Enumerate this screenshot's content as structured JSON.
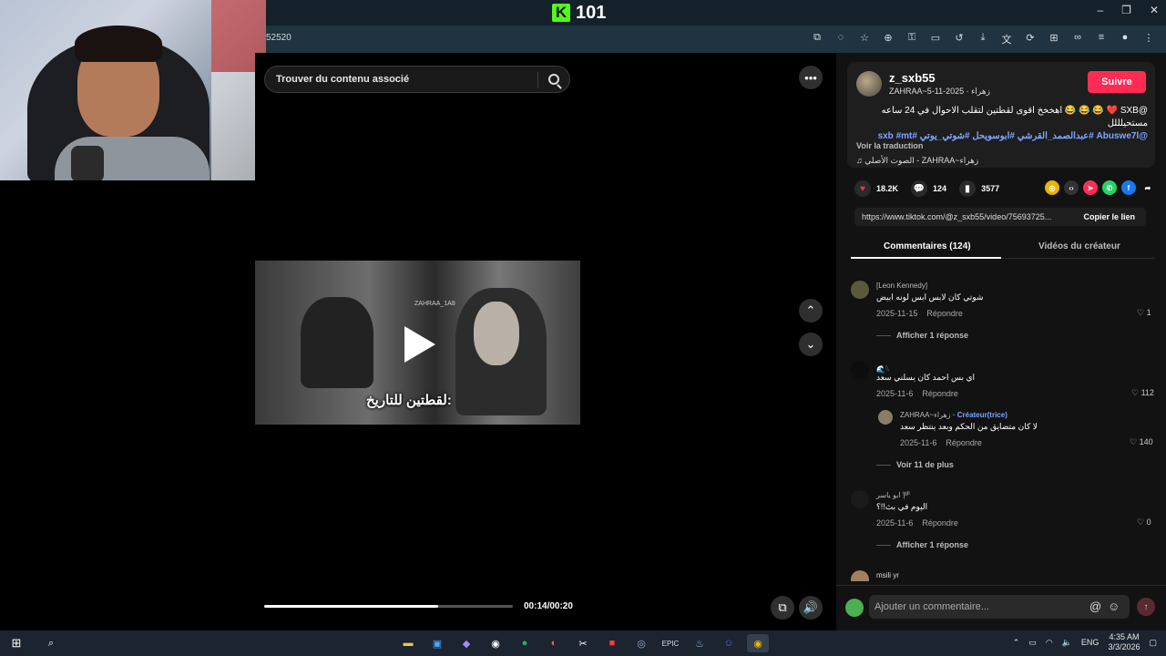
{
  "browser": {
    "kick_logo": "K",
    "viewer_count": "101",
    "address": "52520",
    "window_buttons": [
      "–",
      "❐",
      "✕"
    ]
  },
  "video": {
    "search_placeholder": "Trouver du contenu associé",
    "caption": "لقطتين للتاريخ:",
    "watermark": "ZAHRAA_1A8",
    "time": "00:14/00:20",
    "progress_fraction": 0.7
  },
  "post": {
    "username": "z_sxb55",
    "subline": "ZAHRAA~زهراء · 2025-11-5",
    "follow_label": "Suivre",
    "description_text": "@SXB ❤️ 😂 😂 😂 اهخخخ اقوى لقطتين لتقلب الاحوال في 24 ساعه مستحيلللل",
    "description_tags": "@Abuswe7l #عبدالصمد_القرشي #ابوسويحل #شوتي_يوتي #sxb #mt",
    "translate_label": "Voir la traduction",
    "music": "الصوت الأصلي - ZAHRAA~زهراء",
    "likes": "18.2K",
    "comments_count": "124",
    "saves": "3577",
    "link": "https://www.tiktok.com/@z_sxb55/video/75693725...",
    "copy_link_label": "Copier le lien",
    "tab_comments": "Commentaires (124)",
    "tab_videos": "Vidéos du créateur"
  },
  "comments": [
    {
      "name": "[Leon Kennedy]",
      "text": "شوتي كان لابس ابس لونه ابيض",
      "date": "2025-11-15",
      "reply": "Répondre",
      "likes": "1",
      "more": "Afficher 1 réponse"
    },
    {
      "name": "🌊𓆩",
      "text": "اي بس احمد كان يسلني سعد",
      "date": "2025-11-6",
      "reply": "Répondre",
      "likes": "112"
    },
    {
      "name": "ZAHRAA~زهراء",
      "creator": "· Créateur(trice)",
      "text": "لا كان متضايق من الحكم وبعد ينتظر سعد",
      "date": "2025-11-6",
      "reply": "Répondre",
      "likes": "140",
      "more": "Voir 11 de plus"
    },
    {
      "name": "ابو ياسر 🏴",
      "text": "اليوم في بث!!؟",
      "date": "2025-11-6",
      "reply": "Répondre",
      "likes": "0",
      "more": "Afficher 1 réponse"
    },
    {
      "name": "msili yr",
      "text": "",
      "date": "",
      "reply": "",
      "likes": ""
    }
  ],
  "composer": {
    "placeholder": "Ajouter un commentaire...",
    "at": "@",
    "emoji": "☺"
  },
  "taskbar": {
    "lang": "ENG",
    "time": "4:35 AM",
    "date": "3/3/2026"
  },
  "colors": {
    "follow": "#fe2c55",
    "kick_green": "#53fc18",
    "tag_blue": "#7ea6ff"
  }
}
